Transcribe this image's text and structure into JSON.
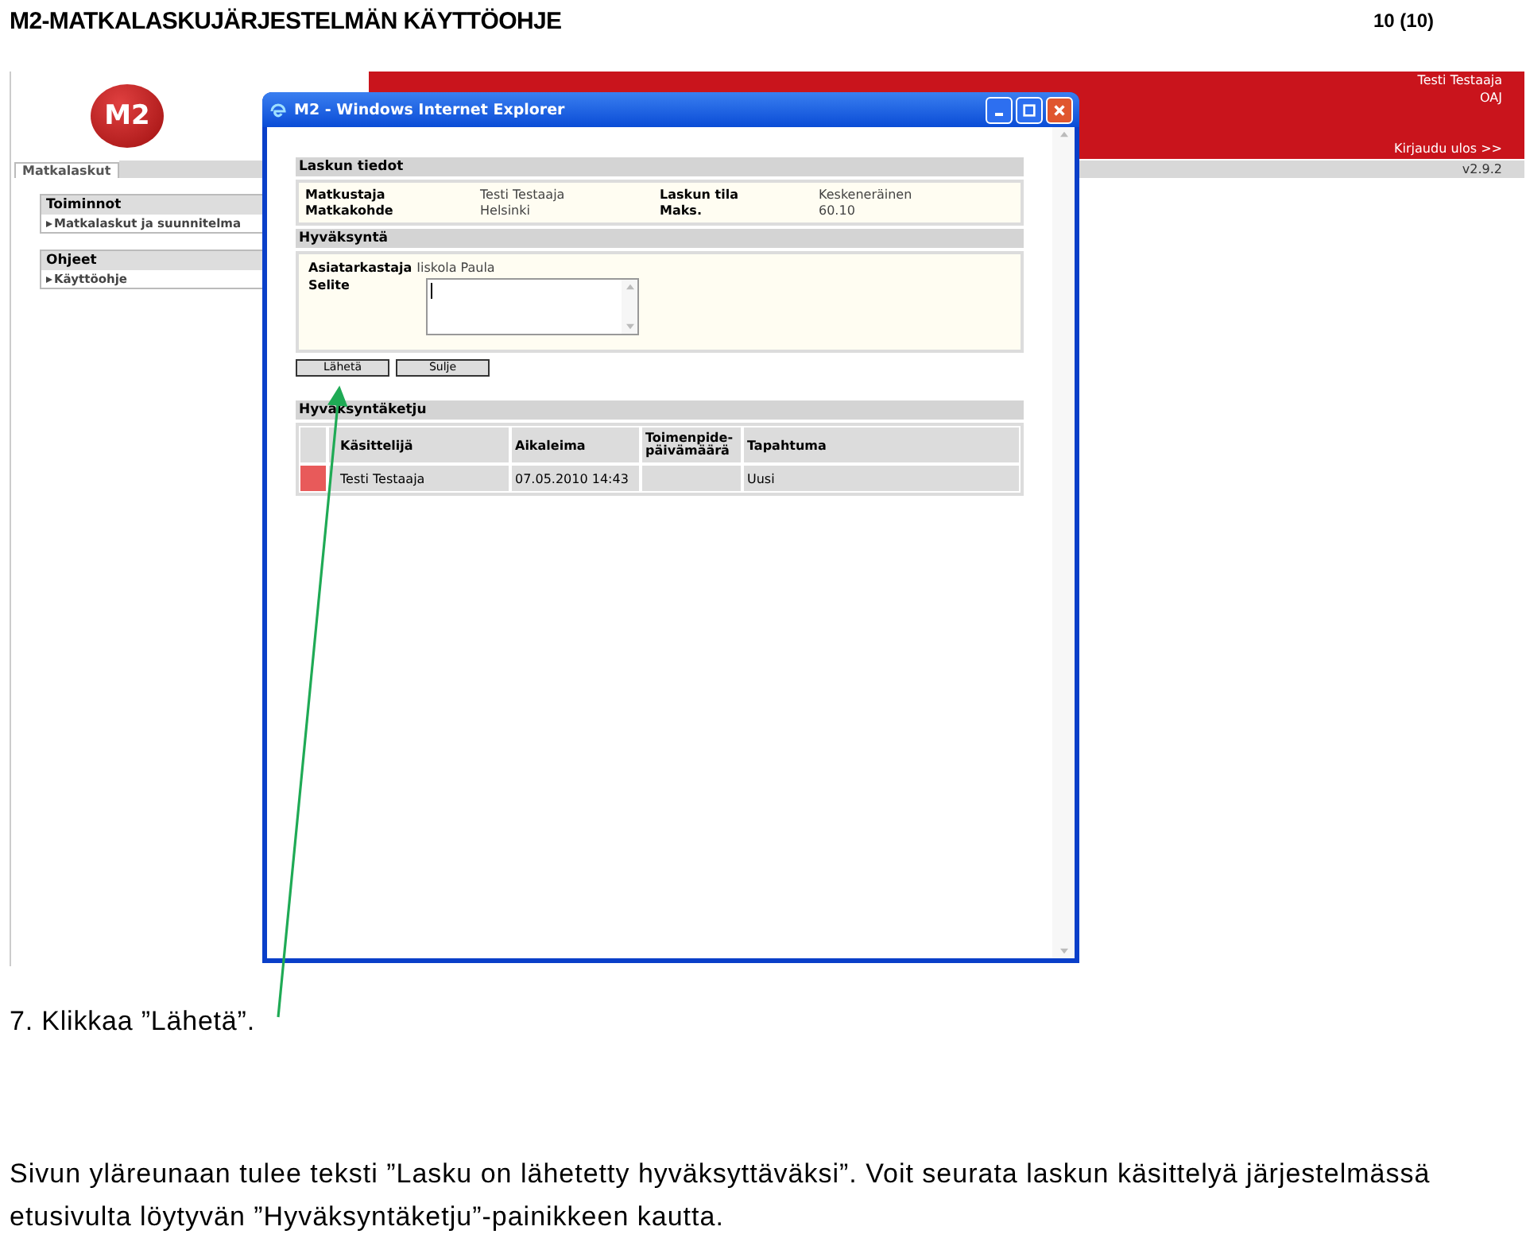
{
  "document": {
    "header_title": "M2-MATKALASKUJÄRJESTELMÄN KÄYTTÖOHJE",
    "page_number": "10 (10)",
    "step": "7. Klikkaa ”Lähetä”.",
    "paragraph": "Sivun yläreunaan tulee teksti ”Lasku on lähetetty hyväksyttäväksi”. Voit seurata laskun käsittelyä järjestelmässä etusivulta löytyvän ”Hyväksyntäketju”-painikkeen kautta."
  },
  "app": {
    "logo": "M2",
    "user_name": "Testi Testaaja",
    "organization": "OAJ",
    "logout_link": "Kirjaudu ulos >>",
    "version": "v2.9.2",
    "tabs": [
      {
        "label": "Matkalaskut",
        "selected": true
      }
    ],
    "sidebar": [
      {
        "title": "Toiminnot",
        "items": [
          "Matkalaskut ja suunnitelma"
        ]
      },
      {
        "title": "Ohjeet",
        "items": [
          "Käyttöohje"
        ]
      }
    ]
  },
  "popup": {
    "title": "M2 - Windows Internet Explorer",
    "invoice_section": {
      "title": "Laskun tiedot",
      "fields": [
        {
          "label": "Matkustaja",
          "value": "Testi Testaaja"
        },
        {
          "label": "Laskun tila",
          "value": "Keskeneräinen"
        },
        {
          "label": "Matkakohde",
          "value": "Helsinki"
        },
        {
          "label": "Maks.",
          "value": "60.10"
        }
      ]
    },
    "approval_section": {
      "title": "Hyväksyntä",
      "reviewer_label": "Asiatarkastaja",
      "reviewer": "Iiskola Paula",
      "comment_label": "Selite"
    },
    "buttons": [
      "Lähetä",
      "Sulje"
    ],
    "chain": {
      "title": "Hyväksyntäketju",
      "columns": [
        "Käsittelijä",
        "Aikaleima",
        "Toimenpide-päivämäärä",
        "Tapahtuma"
      ],
      "rows": [
        {
          "color": "#e85a5a",
          "handler": "Testi Testaaja",
          "timestamp": "07.05.2010 14:43",
          "event": "Uusi"
        }
      ]
    }
  }
}
